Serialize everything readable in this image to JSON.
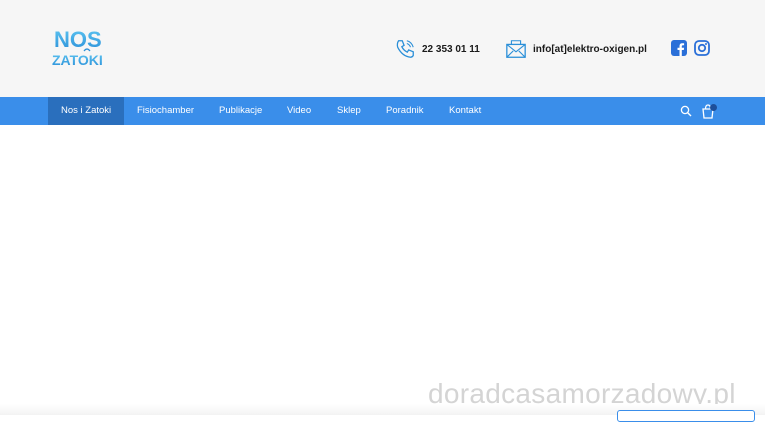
{
  "brand": {
    "logo_line1": "NOS",
    "logo_line2": "ZATOKI",
    "accent": "#3a8eea",
    "nav_active_bg": "#2a6fbd"
  },
  "header": {
    "phone": "22 353 01 11",
    "email": "info[at]elektro-oxigen.pl",
    "phone_icon": "phone-icon",
    "email_icon": "envelope-icon",
    "social": [
      "facebook-icon",
      "instagram-icon"
    ]
  },
  "nav": {
    "items": [
      {
        "label": "Nos i Zatoki",
        "active": true
      },
      {
        "label": "Fisiochamber"
      },
      {
        "label": "Publikacje"
      },
      {
        "label": "Video"
      },
      {
        "label": "Sklep"
      },
      {
        "label": "Poradnik"
      },
      {
        "label": "Kontakt"
      }
    ],
    "search_icon": "search-icon",
    "cart_icon": "shopping-bag-icon"
  },
  "watermark": {
    "text": "doradcasamorzadowy.pl"
  }
}
